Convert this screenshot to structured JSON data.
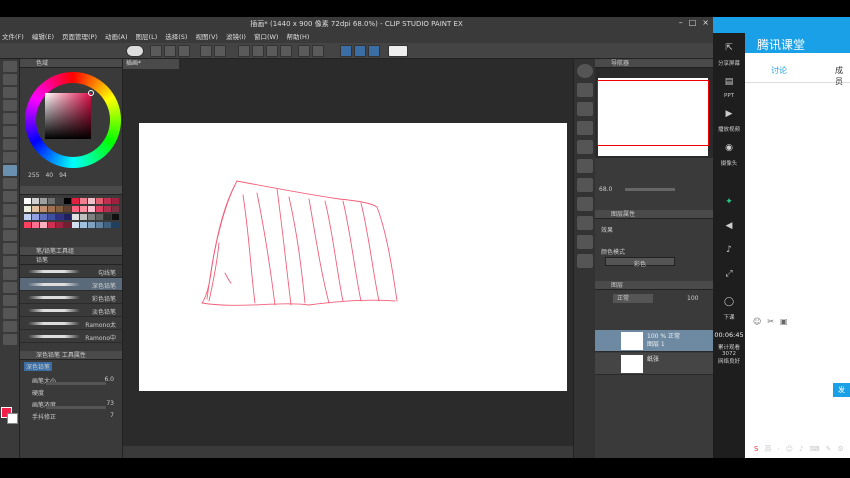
{
  "window": {
    "title": "插画* (1440 x 900 像素 72dpi 68.0%) - CLIP STUDIO PAINT EX",
    "controls": [
      "–",
      "□",
      "×"
    ]
  },
  "menu": [
    "文件(F)",
    "编辑(E)",
    "页面管理(P)",
    "动画(A)",
    "图层(L)",
    "选择(S)",
    "视图(V)",
    "滤镜(I)",
    "窗口(W)",
    "帮助(H)"
  ],
  "left_panel": {
    "color_panel_title": "色域",
    "hsv": {
      "h": "255",
      "s": "40",
      "v": "94"
    },
    "subtool_tab": "铅笔",
    "subtool_group": "笔/铅笔工具组",
    "brushes": [
      {
        "label": "勾线笔",
        "active": false
      },
      {
        "label": "深色铅笔",
        "active": true
      },
      {
        "label": "彩色铅笔",
        "active": false
      },
      {
        "label": "淡色铅笔",
        "active": false
      },
      {
        "label": "Ramono太",
        "active": false
      },
      {
        "label": "Ramono中",
        "active": false
      }
    ],
    "tool_property_title": "深色铅笔 工具属性",
    "property_label": "深色铅笔",
    "properties": [
      {
        "label": "画笔大小",
        "value": "6.0"
      },
      {
        "label": "硬度",
        "value": ""
      },
      {
        "label": "画笔浓度",
        "value": "73"
      },
      {
        "label": "手抖修正",
        "value": "7"
      }
    ],
    "palette_colors": [
      "#ffffff",
      "#d0d0d0",
      "#a0a0a0",
      "#707070",
      "#404040",
      "#000000",
      "#e02040",
      "#f08090",
      "#f0c0c8",
      "#e06070",
      "#c03050",
      "#a02040",
      "#f0f0e0",
      "#e0c0a0",
      "#c09070",
      "#a07050",
      "#806040",
      "#604030",
      "#ff6080",
      "#ff90a0",
      "#ffc0d0",
      "#e04060",
      "#b03050",
      "#803040",
      "#c0d0f0",
      "#90a0e0",
      "#6070c0",
      "#4050a0",
      "#303080",
      "#202060",
      "#e0e0e0",
      "#c0c0c0",
      "#808080",
      "#606060",
      "#303030",
      "#101010",
      "#ff4060",
      "#ff7090",
      "#ffb0c0",
      "#d03050",
      "#a02040",
      "#702030",
      "#d0e0f0",
      "#a0c0e0",
      "#80a0c0",
      "#6080a0",
      "#406080",
      "#204060"
    ]
  },
  "canvas": {
    "tab_label": "插画*",
    "stroke_color": "#f0607a"
  },
  "right_panel": {
    "navigator_title": "导航器",
    "zoom": "68.0",
    "layer_prop_title": "图层属性",
    "effect_label": "效果",
    "color_mode_label": "颜色模式",
    "color_mode_value": "彩色",
    "layers_title": "图层",
    "blend_mode": "正常",
    "opacity": "100",
    "layers": [
      {
        "line1": "100 % 正常",
        "line2": "图层 1",
        "selected": true
      },
      {
        "line1": "",
        "line2": "纸张",
        "selected": false
      }
    ]
  },
  "tencent": {
    "app_title": "腾讯课堂",
    "tab_discuss": "讨论",
    "tab_members": "成员",
    "side_buttons": [
      {
        "icon": "share-screen-icon",
        "glyph": "⇱",
        "label": "分享屏幕"
      },
      {
        "icon": "ppt-icon",
        "glyph": "▤",
        "label": "PPT"
      },
      {
        "icon": "play-video-icon",
        "glyph": "▶",
        "label": "播放视频"
      },
      {
        "icon": "camera-icon",
        "glyph": "◉",
        "label": "摄像头"
      }
    ],
    "mic_label": "下课",
    "timer": "00:06:45",
    "stat1": "累计观看",
    "stat2": "3072",
    "stat3": "网络良好",
    "send_label": "发"
  },
  "ime": [
    "S",
    "英",
    "·",
    "☺",
    "♪",
    "⌨",
    "✎",
    "⚙"
  ]
}
